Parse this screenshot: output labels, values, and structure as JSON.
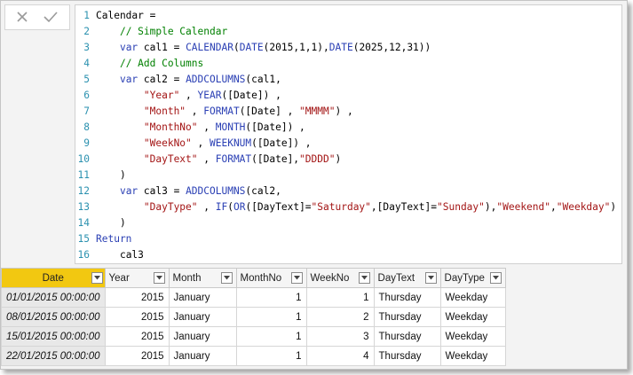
{
  "formula_bar": {
    "cancel_icon": "close-icon",
    "commit_icon": "checkmark-icon",
    "lines": [
      {
        "n": "1",
        "tokens": [
          [
            "p",
            "Calendar ="
          ]
        ]
      },
      {
        "n": "2",
        "tokens": [
          [
            "p",
            "    "
          ],
          [
            "cm",
            "// Simple Calendar"
          ]
        ]
      },
      {
        "n": "3",
        "tokens": [
          [
            "p",
            "    "
          ],
          [
            "kw",
            "var"
          ],
          [
            "p",
            " cal1 = "
          ],
          [
            "fn",
            "CALENDAR"
          ],
          [
            "p",
            "("
          ],
          [
            "fn",
            "DATE"
          ],
          [
            "p",
            "(2015,1,1),"
          ],
          [
            "fn",
            "DATE"
          ],
          [
            "p",
            "(2025,12,31))"
          ]
        ]
      },
      {
        "n": "4",
        "tokens": [
          [
            "p",
            "    "
          ],
          [
            "cm",
            "// Add Columns"
          ]
        ]
      },
      {
        "n": "5",
        "tokens": [
          [
            "p",
            "    "
          ],
          [
            "kw",
            "var"
          ],
          [
            "p",
            " cal2 = "
          ],
          [
            "fn",
            "ADDCOLUMNS"
          ],
          [
            "p",
            "(cal1,"
          ]
        ]
      },
      {
        "n": "6",
        "tokens": [
          [
            "p",
            "        "
          ],
          [
            "str",
            "\"Year\""
          ],
          [
            "p",
            " , "
          ],
          [
            "fn",
            "YEAR"
          ],
          [
            "p",
            "([Date]) ,"
          ]
        ]
      },
      {
        "n": "7",
        "tokens": [
          [
            "p",
            "        "
          ],
          [
            "str",
            "\"Month\""
          ],
          [
            "p",
            " , "
          ],
          [
            "fn",
            "FORMAT"
          ],
          [
            "p",
            "([Date] , "
          ],
          [
            "str",
            "\"MMMM\""
          ],
          [
            "p",
            ") ,"
          ]
        ]
      },
      {
        "n": "8",
        "tokens": [
          [
            "p",
            "        "
          ],
          [
            "str",
            "\"MonthNo\""
          ],
          [
            "p",
            " , "
          ],
          [
            "fn",
            "MONTH"
          ],
          [
            "p",
            "([Date]) ,"
          ]
        ]
      },
      {
        "n": "9",
        "tokens": [
          [
            "p",
            "        "
          ],
          [
            "str",
            "\"WeekNo\""
          ],
          [
            "p",
            " , "
          ],
          [
            "fn",
            "WEEKNUM"
          ],
          [
            "p",
            "([Date]) ,"
          ]
        ]
      },
      {
        "n": "10",
        "tokens": [
          [
            "p",
            "        "
          ],
          [
            "str",
            "\"DayText\""
          ],
          [
            "p",
            " , "
          ],
          [
            "fn",
            "FORMAT"
          ],
          [
            "p",
            "([Date],"
          ],
          [
            "str",
            "\"DDDD\""
          ],
          [
            "p",
            ")"
          ]
        ]
      },
      {
        "n": "11",
        "tokens": [
          [
            "p",
            "    )"
          ]
        ]
      },
      {
        "n": "12",
        "tokens": [
          [
            "p",
            "    "
          ],
          [
            "kw",
            "var"
          ],
          [
            "p",
            " cal3 = "
          ],
          [
            "fn",
            "ADDCOLUMNS"
          ],
          [
            "p",
            "(cal2,"
          ]
        ]
      },
      {
        "n": "13",
        "tokens": [
          [
            "p",
            "        "
          ],
          [
            "str",
            "\"DayType\""
          ],
          [
            "p",
            " , "
          ],
          [
            "fn",
            "IF"
          ],
          [
            "p",
            "("
          ],
          [
            "fn",
            "OR"
          ],
          [
            "p",
            "([DayText]="
          ],
          [
            "str",
            "\"Saturday\""
          ],
          [
            "p",
            ",[DayText]="
          ],
          [
            "str",
            "\"Sunday\""
          ],
          [
            "p",
            "),"
          ],
          [
            "str",
            "\"Weekend\""
          ],
          [
            "p",
            ","
          ],
          [
            "str",
            "\"Weekday\""
          ],
          [
            "p",
            ")"
          ]
        ]
      },
      {
        "n": "14",
        "tokens": [
          [
            "p",
            "    )"
          ]
        ]
      },
      {
        "n": "15",
        "tokens": [
          [
            "kw",
            "Return"
          ]
        ]
      },
      {
        "n": "16",
        "tokens": [
          [
            "p",
            "    "
          ],
          [
            "p",
            "cal3"
          ]
        ]
      }
    ]
  },
  "table": {
    "columns": [
      "Date",
      "Year",
      "Month",
      "MonthNo",
      "WeekNo",
      "DayText",
      "DayType"
    ],
    "selected_column": "Date",
    "rows": [
      [
        "01/01/2015 00:00:00",
        "2015",
        "January",
        "1",
        "1",
        "Thursday",
        "Weekday"
      ],
      [
        "08/01/2015 00:00:00",
        "2015",
        "January",
        "1",
        "2",
        "Thursday",
        "Weekday"
      ],
      [
        "15/01/2015 00:00:00",
        "2015",
        "January",
        "1",
        "3",
        "Thursday",
        "Weekday"
      ],
      [
        "22/01/2015 00:00:00",
        "2015",
        "January",
        "1",
        "4",
        "Thursday",
        "Weekday"
      ]
    ]
  },
  "colors": {
    "selected_header": "#f2c811",
    "keyword": "#2a3fb4",
    "string": "#a31515",
    "comment": "#008000",
    "line_number": "#2b91af"
  }
}
